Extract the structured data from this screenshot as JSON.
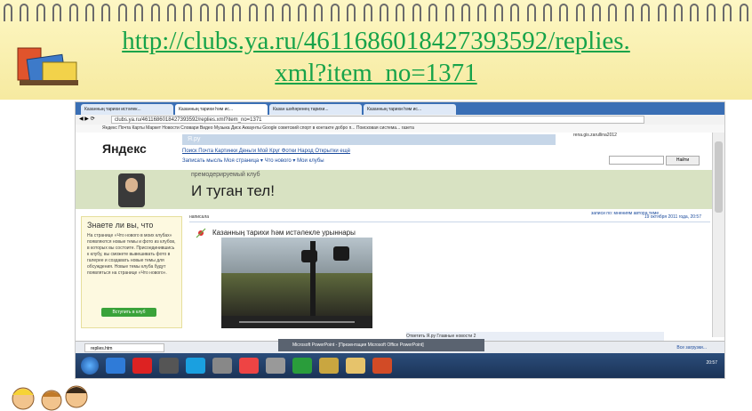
{
  "slide": {
    "link_line1": "http://clubs.ya.ru/4611686018427393592/replies.",
    "link_line2": "xml?item_no=1371"
  },
  "browser": {
    "tabs": [
      {
        "label": "Казанның тарихи истәлек...",
        "active": false
      },
      {
        "label": "Казанның тарихи һәм ис...",
        "active": true
      },
      {
        "label": "Казан шәһәренең тарихи...",
        "active": false
      },
      {
        "label": "Казанның тарихи һәм ис...",
        "active": false
      }
    ],
    "address": "clubs.ya.ru/4611686018427393592/replies.xml?item_no=1371",
    "bookmarks": "Яндекс   Почта   Карты   Маркет   Новости   Словари   Видео   Музыка   Диск   Аккаунты Google   советский спорт   в контакте добро п...   Поисковая система...   газета"
  },
  "yandex": {
    "logo": "Яндекс",
    "ru_label": "Я.ру",
    "nav": "Поиск   Почта   Картинки   Деньги   Мой Круг   Фотки   Народ   Открытки   ещё",
    "menu": "Записать мысль   Моя страница ▾   Что нового ▾   Мои клубы",
    "user": "rena.gis.zarullina2012",
    "search_button": "Найти",
    "club_subtitle": "премодерируемый клуб",
    "club_title": "И туган тел!",
    "posts_meta": "записи по: мнениям  автора  теме"
  },
  "sidebar_tip": {
    "heading": "Знаете ли вы, что",
    "text": "На странице «Что нового в моих клубах» появляются новые темы и фото из клубов, в которых вы состоите. Присоединившись к клубу, вы сможете вывешивать фото в галерее и создавать новые темы для обсуждения. Новые темы клуба будут появляться на странице «Что нового».",
    "button": "Вступить в клуб"
  },
  "post": {
    "header_label": "написала",
    "date": "19 октября 2011 года, 20:57",
    "title": "Казанның тарихи һәм истәлекле урыннары"
  },
  "comments_bar": "Ответить   Я.ру   Главные новости   2",
  "downloads": {
    "item": "replies.htm",
    "show_all": "Все загрузки..."
  },
  "ppt_popup": "Microsoft PowerPoint - [Презентация Microsoft Office PowerPoint]",
  "taskbar": {
    "icons": [
      {
        "name": "ie-icon",
        "color": "#2f7bd8"
      },
      {
        "name": "opera-icon",
        "color": "#d22"
      },
      {
        "name": "media-icon",
        "color": "#555"
      },
      {
        "name": "skype-icon",
        "color": "#1aa0e0"
      },
      {
        "name": "window-icon",
        "color": "#888"
      },
      {
        "name": "chrome-icon",
        "color": "#e44"
      },
      {
        "name": "app-icon",
        "color": "#999"
      },
      {
        "name": "whatsapp-icon",
        "color": "#2a9d3b"
      },
      {
        "name": "paint-icon",
        "color": "#c9a640"
      },
      {
        "name": "folder-icon",
        "color": "#e6c36b"
      },
      {
        "name": "powerpoint-icon",
        "color": "#d24b26"
      }
    ],
    "clock": "20:57"
  }
}
